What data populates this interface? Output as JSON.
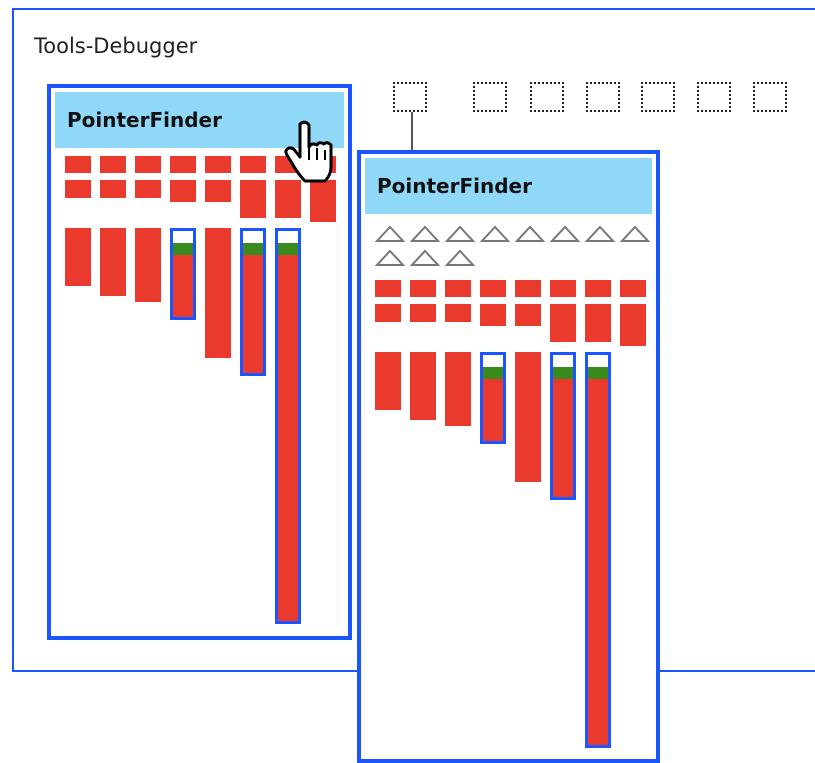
{
  "window": {
    "title": "Tools-Debugger"
  },
  "panels": [
    {
      "title": "PointerFinder"
    },
    {
      "title": "PointerFinder"
    }
  ],
  "colors": {
    "frame": "#1a55ff",
    "header": "#8fd8f8",
    "block": "#e93a2d",
    "marker": "#3a8a1e"
  },
  "icons": {
    "cursor": "hand-pointer-icon",
    "placeholder": "dotted-square-icon",
    "triangle": "outline-triangle-icon"
  }
}
